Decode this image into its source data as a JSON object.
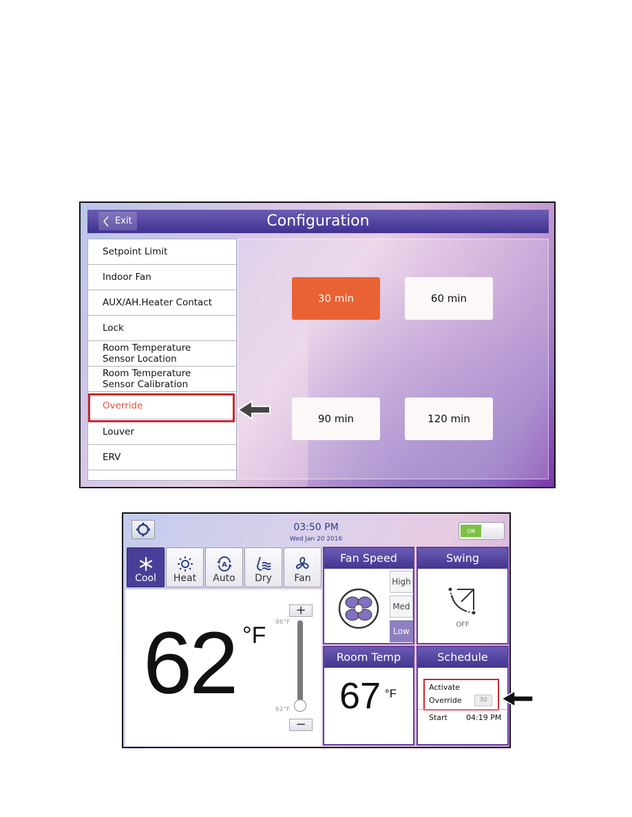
{
  "config_screen": {
    "header": {
      "exit_label": "Exit",
      "title": "Configuration"
    },
    "menu_items": [
      {
        "label": "Setpoint Limit",
        "selected": false
      },
      {
        "label": "Indoor Fan",
        "selected": false
      },
      {
        "label": "AUX/AH.Heater Contact",
        "selected": false
      },
      {
        "label": "Lock",
        "selected": false
      },
      {
        "label_line1": "Room Temperature",
        "label_line2": "Sensor Location",
        "selected": false
      },
      {
        "label_line1": "Room Temperature",
        "label_line2": "Sensor Calibration",
        "selected": false
      },
      {
        "label": "Override",
        "selected": true
      },
      {
        "label": "Louver",
        "selected": false
      },
      {
        "label": "ERV",
        "selected": false
      }
    ],
    "override_options": [
      {
        "label": "30 min",
        "selected": true
      },
      {
        "label": "60 min",
        "selected": false
      },
      {
        "label": "90 min",
        "selected": false
      },
      {
        "label": "120 min",
        "selected": false
      }
    ]
  },
  "main_screen": {
    "time": "03:50 PM",
    "date": "Wed Jan 20 2016",
    "power_toggle": {
      "label": "ON",
      "state": "on"
    },
    "modes": [
      {
        "label": "Cool",
        "icon": "snowflake-icon",
        "active": true
      },
      {
        "label": "Heat",
        "icon": "sun-icon",
        "active": false
      },
      {
        "label": "Auto",
        "icon": "auto-cycle-icon",
        "active": false
      },
      {
        "label": "Dry",
        "icon": "water-drop-icon",
        "active": false
      },
      {
        "label": "Fan",
        "icon": "fan-icon",
        "active": false
      }
    ],
    "setpoint": {
      "value": "62",
      "unit": "°F",
      "max_label": "86°F",
      "min_label": "62°F",
      "increase_label": "+",
      "decrease_label": "−"
    },
    "fan_speed": {
      "title": "Fan Speed",
      "options": [
        {
          "label": "High",
          "active": false
        },
        {
          "label": "Med",
          "active": false
        },
        {
          "label": "Low",
          "active": true
        }
      ]
    },
    "swing": {
      "title": "Swing",
      "status": "OFF"
    },
    "room_temp": {
      "title": "Room Temp",
      "value": "67",
      "unit": "°F"
    },
    "schedule": {
      "title": "Schedule",
      "activate_label": "Activate",
      "override_label": "Override",
      "override_value": "30",
      "start_label": "Start",
      "start_time": "04:19 PM"
    }
  },
  "colors": {
    "header_purple": "#4a3f98",
    "selected_orange": "#e96234",
    "highlight_red": "#c8262e",
    "toggle_green": "#7cc242"
  }
}
